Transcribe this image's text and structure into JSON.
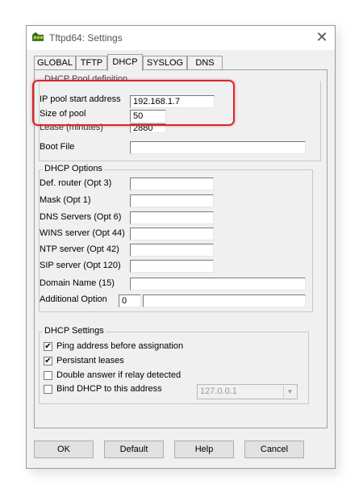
{
  "window": {
    "title": "Tftpd64: Settings"
  },
  "tabs": [
    {
      "label": "GLOBAL"
    },
    {
      "label": "TFTP"
    },
    {
      "label": "DHCP",
      "active": true
    },
    {
      "label": "SYSLOG"
    },
    {
      "label": "DNS"
    }
  ],
  "pool": {
    "group_title": "DHCP Pool definition",
    "start_label": "IP pool start address",
    "start_value": "192.168.1.7",
    "size_label": "Size of pool",
    "size_value": "50",
    "lease_label": "Lease (minutes)",
    "lease_value": "2880",
    "bootfile_label": "Boot File",
    "bootfile_value": ""
  },
  "options": {
    "group_title": "DHCP Options",
    "fields": [
      {
        "label": "Def. router (Opt 3)",
        "value": ""
      },
      {
        "label": "Mask (Opt 1)",
        "value": ""
      },
      {
        "label": "DNS Servers (Opt 6)",
        "value": ""
      },
      {
        "label": "WINS server (Opt 44)",
        "value": ""
      },
      {
        "label": "NTP server (Opt 42)",
        "value": ""
      },
      {
        "label": "SIP server (Opt 120)",
        "value": ""
      }
    ],
    "domain_label": "Domain Name (15)",
    "domain_value": "",
    "additional_label": "Additional Option",
    "additional_num": "0",
    "additional_value": ""
  },
  "settings": {
    "group_title": "DHCP Settings",
    "checks": [
      {
        "label": "Ping address before assignation",
        "checked": true
      },
      {
        "label": "Persistant leases",
        "checked": true
      },
      {
        "label": "Double answer if relay detected",
        "checked": false
      },
      {
        "label": "Bind DHCP to this address",
        "checked": false
      }
    ],
    "bind_address": "127.0.0.1"
  },
  "buttons": {
    "ok": "OK",
    "default": "Default",
    "help": "Help",
    "cancel": "Cancel"
  },
  "colors": {
    "highlight": "#d9262b",
    "window_bg": "#f0f0f0"
  }
}
